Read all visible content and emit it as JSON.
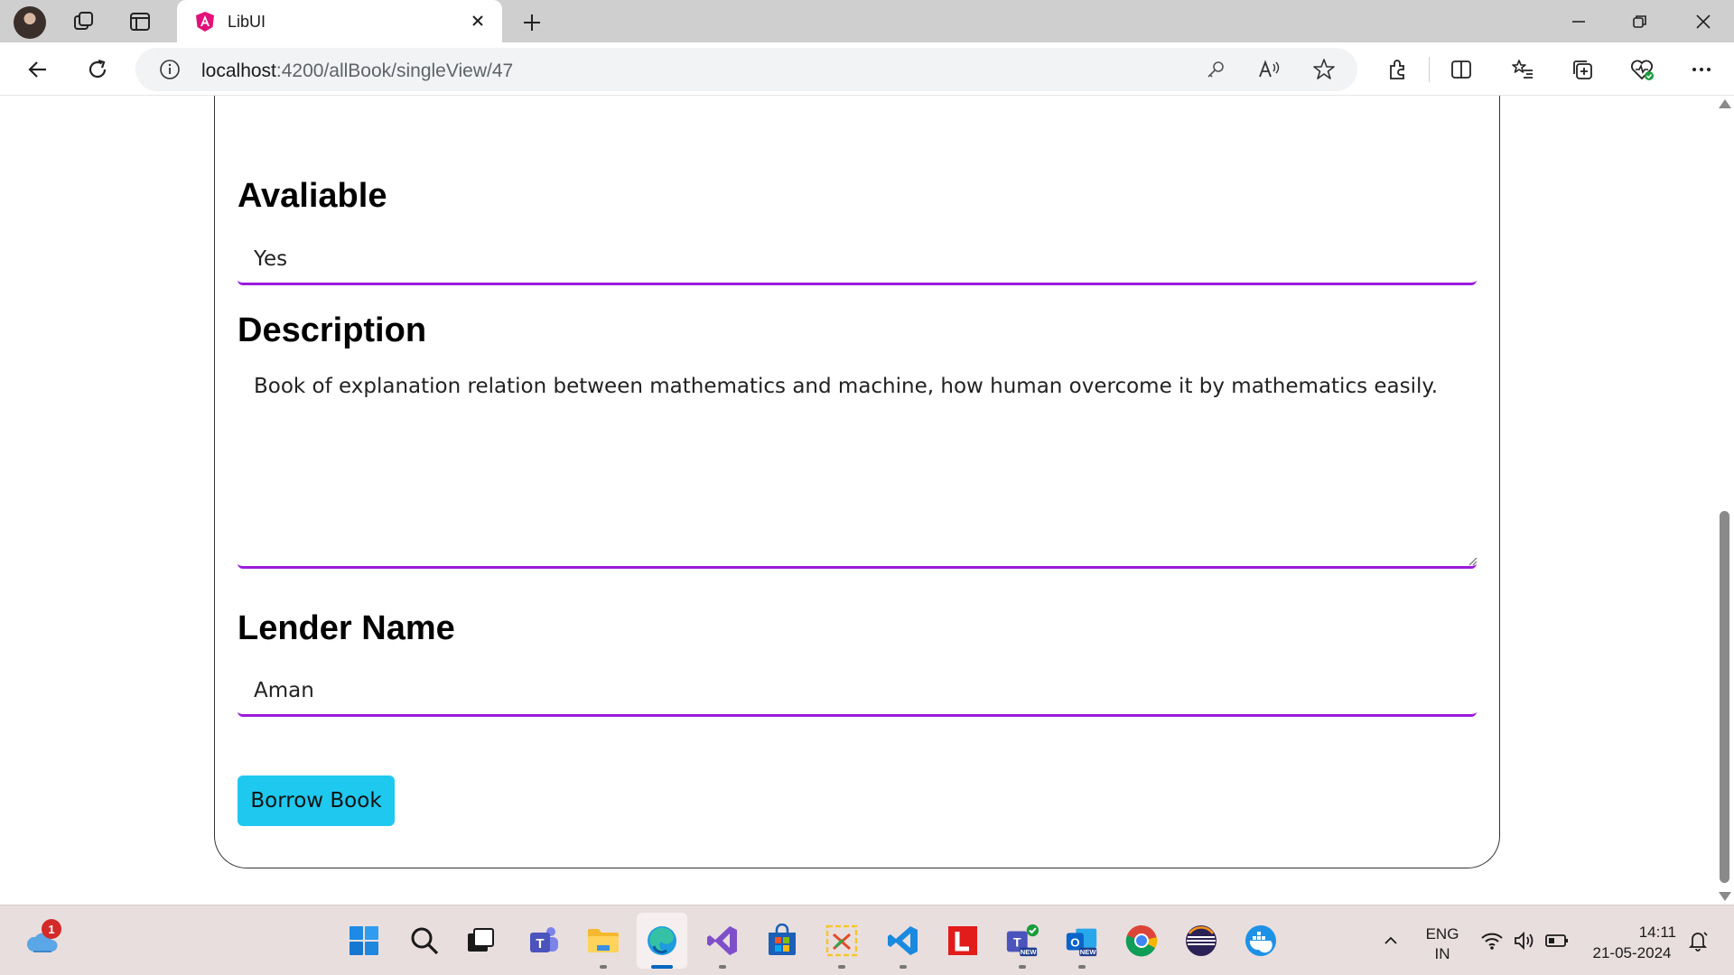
{
  "browser": {
    "tab_title": "LibUI",
    "url_host": "localhost",
    "url_rest": ":4200/allBook/singleView/47"
  },
  "form": {
    "available_label": "Avaliable",
    "available_value": "Yes",
    "description_label": "Description",
    "description_value": "Book of explanation relation between mathematics and machine, how human overcome it by mathematics easily.",
    "lender_label": "Lender Name",
    "lender_value": "Aman",
    "borrow_button": "Borrow Book"
  },
  "colors": {
    "input_underline": "#9b1bdc",
    "button": "#1fc8ef"
  },
  "taskbar": {
    "weather_badge": "1",
    "apps": [
      "start-icon",
      "search-icon",
      "task-view-icon",
      "teams-icon",
      "file-explorer-icon",
      "edge-icon",
      "visual-studio-icon",
      "microsoft-store-icon",
      "toolbox-icon",
      "vscode-icon",
      "l-app-icon",
      "teams-new-icon",
      "outlook-new-icon",
      "chrome-icon",
      "eclipse-icon",
      "docker-icon"
    ],
    "language_line1": "ENG",
    "language_line2": "IN",
    "time": "14:11",
    "date": "21-05-2024"
  }
}
